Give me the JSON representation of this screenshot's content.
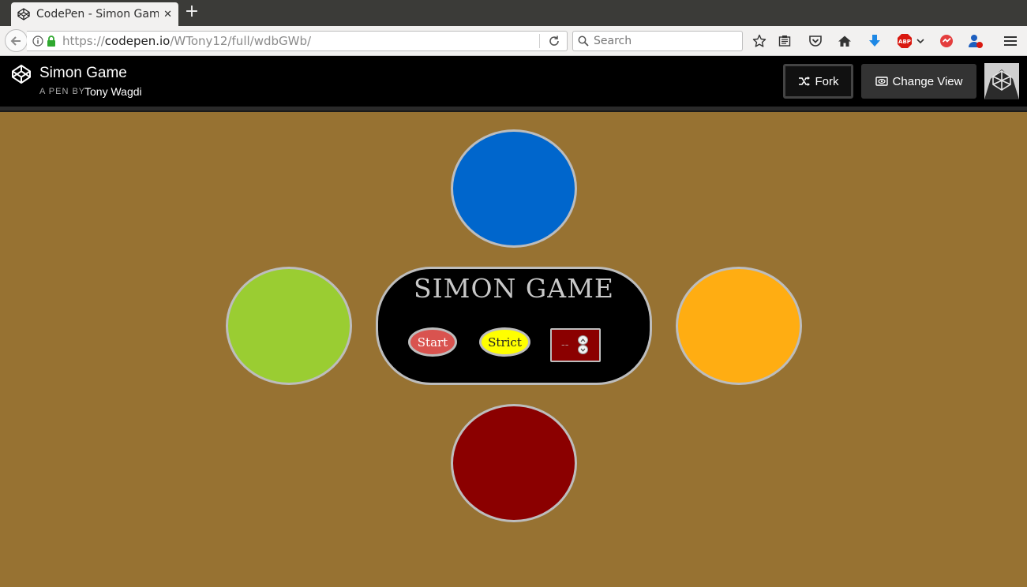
{
  "browser": {
    "tab_title": "CodePen - Simon Game",
    "tab_close": "✕",
    "new_tab": "+",
    "url_scheme": "https://",
    "url_host": "codepen.io",
    "url_path": "/WTony12/full/wdbGWb/",
    "search_placeholder": "Search"
  },
  "codepen": {
    "title": "Simon Game",
    "by_label": "A PEN BY",
    "author": "Tony Wagdi",
    "fork_label": "Fork",
    "change_view_label": "Change View"
  },
  "game": {
    "title": "SIMON GAME",
    "start_label": "Start",
    "strict_label": "Strict",
    "count_value": "--",
    "colors": {
      "background": "#977232",
      "pad_blue": "#0066cc",
      "pad_green": "#9acd32",
      "pad_orange": "#ffad12",
      "pad_red": "#8b0000",
      "start_button": "#d9534f",
      "strict_button": "#ffff00",
      "count_box": "#8b0000"
    }
  }
}
